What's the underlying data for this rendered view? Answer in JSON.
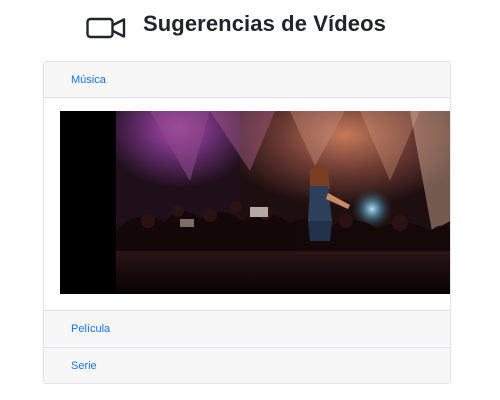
{
  "header": {
    "title": "Sugerencias de Vídeos",
    "icon": "video-camera-icon"
  },
  "accordion": {
    "items": [
      {
        "label": "Música",
        "expanded": true,
        "content": "video-player"
      },
      {
        "label": "Película",
        "expanded": false
      },
      {
        "label": "Serie",
        "expanded": false
      }
    ]
  },
  "colors": {
    "link": "#1a73e8",
    "header_bg": "#f7f7f7",
    "border": "#dfe2e6",
    "title": "#212529"
  }
}
